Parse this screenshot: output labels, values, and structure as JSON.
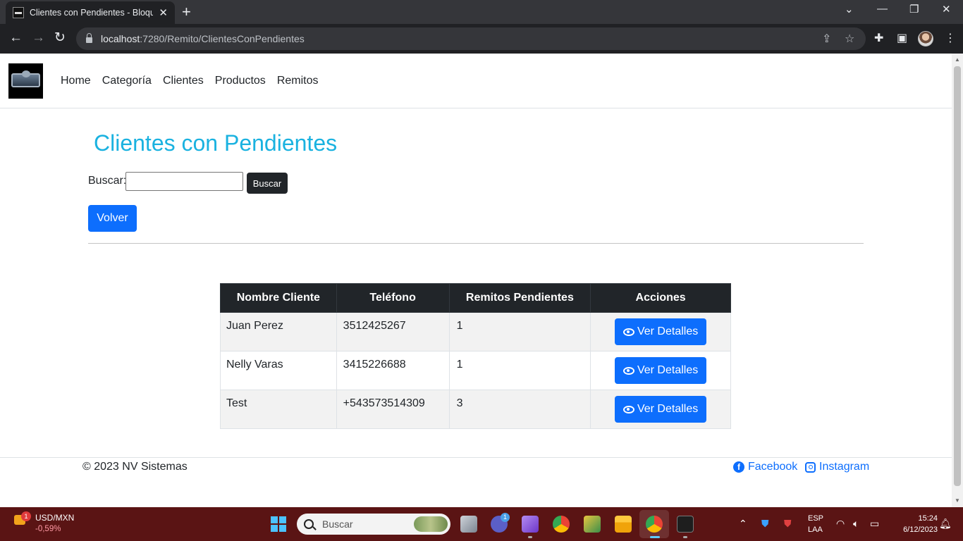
{
  "browser": {
    "tab_title": "Clientes con Pendientes - Bloque",
    "url_host": "localhost",
    "url_rest": ":7280/Remito/ClientesConPendientes"
  },
  "navbar": {
    "links": [
      "Home",
      "Categoría",
      "Clientes",
      "Productos",
      "Remitos"
    ]
  },
  "page": {
    "title": "Clientes con Pendientes",
    "search_label": "Buscar:",
    "search_value": "",
    "search_button": "Buscar",
    "back_button": "Volver"
  },
  "table": {
    "headers": [
      "Nombre Cliente",
      "Teléfono",
      "Remitos Pendientes",
      "Acciones"
    ],
    "rows": [
      {
        "name": "Juan Perez",
        "phone": "3512425267",
        "pending": "1",
        "action": "Ver Detalles"
      },
      {
        "name": "Nelly Varas",
        "phone": "3415226688",
        "pending": "1",
        "action": "Ver Detalles"
      },
      {
        "name": "Test",
        "phone": "+543573514309",
        "pending": "3",
        "action": "Ver Detalles"
      }
    ]
  },
  "footer": {
    "copyright": "© 2023 NV Sistemas",
    "facebook": "Facebook",
    "instagram": "Instagram"
  },
  "taskbar": {
    "weather_badge": "1",
    "stock_name": "USD/MXN",
    "stock_change": "-0,59%",
    "search_placeholder": "Buscar",
    "teams_badge": "1",
    "lang_top": "ESP",
    "lang_bottom": "LAA",
    "time": "15:24",
    "date": "6/12/2023"
  },
  "colors": {
    "title": "#1ab2e0",
    "primary": "#0d6efd",
    "dark": "#212529",
    "taskbar": "#5a1414"
  }
}
